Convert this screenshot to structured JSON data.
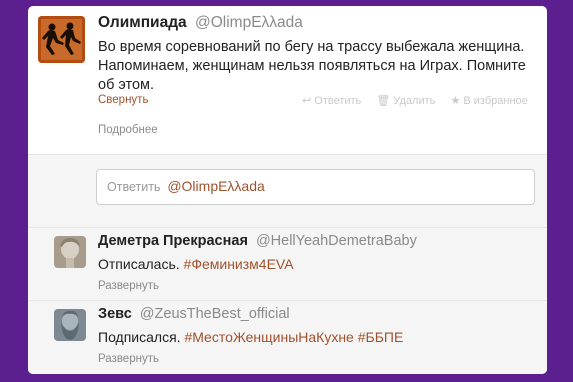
{
  "main_tweet": {
    "name": "Олимпиада",
    "handle": "@OlimpΕλλada",
    "text": "Во время соревнований по бегу на трассу выбежала женщина. Напоминаем, женщинам нельзя появляться на Играх. Помните об этом.",
    "collapse_label": "Свернуть",
    "actions": {
      "reply": "↩ Ответить",
      "delete": "🗑 Удалить",
      "favorite": "★ В избранное"
    },
    "details_label": "Подробнее"
  },
  "reply_box": {
    "placeholder": "Ответить",
    "mention": "@OlimpΕλλada"
  },
  "replies": [
    {
      "name": "Деметра Прекрасная",
      "handle": "@HellYeahDemetraBaby",
      "text": "Отписалась.",
      "hashtags": "#Феминизм4EVA",
      "expand_label": "Развернуть"
    },
    {
      "name": "Зевс",
      "handle": "@ZeusTheBest_official",
      "text": "Подписался.",
      "hashtags": "#МестоЖенщиныНаКухне #ББПЕ",
      "expand_label": "Развернуть"
    }
  ],
  "colors": {
    "background": "#5b1f8f",
    "accent_link": "#a0522d",
    "avatar_olympics": "#b44b11"
  },
  "icons": {
    "main_avatar": "olympic-runners-avatar",
    "reply1_avatar": "greek-statue-avatar",
    "reply2_avatar": "zeus-statue-avatar"
  }
}
